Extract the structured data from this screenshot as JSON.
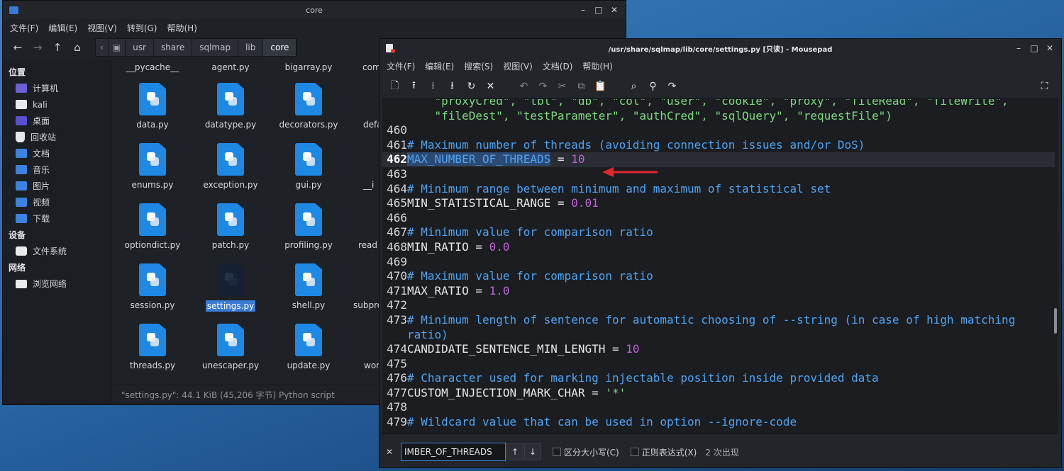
{
  "file_manager": {
    "title": "core",
    "menu": [
      "文件(F)",
      "编辑(E)",
      "视图(V)",
      "转到(G)",
      "帮助(H)"
    ],
    "path": [
      "usr",
      "share",
      "sqlmap",
      "lib",
      "core"
    ],
    "sidebar": {
      "places_heading": "位置",
      "places": [
        "计算机",
        "kali",
        "桌面",
        "回收站",
        "文档",
        "音乐",
        "图片",
        "视频",
        "下载"
      ],
      "devices_heading": "设备",
      "devices": [
        "文件系统"
      ],
      "network_heading": "网络",
      "network": [
        "浏览网络"
      ]
    },
    "files_top_row": [
      "__pycache__",
      "agent.py",
      "bigarray.py",
      "com"
    ],
    "files": [
      [
        "data.py",
        "datatype.py",
        "decorators.py",
        "defa"
      ],
      [
        "enums.py",
        "exception.py",
        "gui.py",
        "__i"
      ],
      [
        "optiondict.py",
        "patch.py",
        "profiling.py",
        "read"
      ],
      [
        "session.py",
        "settings.py",
        "shell.py",
        "subpro"
      ],
      [
        "threads.py",
        "unescaper.py",
        "update.py",
        "wor"
      ]
    ],
    "status": "\"settings.py\": 44.1 KiB (45,206 字节) Python script"
  },
  "mousepad": {
    "title": "/usr/share/sqlmap/lib/core/settings.py [只读] - Mousepad",
    "menu": [
      "文件(F)",
      "编辑(E)",
      "搜索(S)",
      "视图(V)",
      "文档(D)",
      "帮助(H)"
    ],
    "code_lines": [
      {
        "n": "",
        "s": [
          {
            "t": "    \"proxyCred\", \"tbl\", \"db\", \"col\", \"user\", \"cookie\", \"proxy\", \"fileRead\", \"fileWrite\",",
            "c": "c-str"
          }
        ]
      },
      {
        "n": "",
        "s": [
          {
            "t": "    \"fileDest\", \"testParameter\", \"authCred\", \"sqlQuery\", \"requestFile\")",
            "c": "c-str"
          }
        ]
      },
      {
        "n": "460",
        "s": []
      },
      {
        "n": "461",
        "s": [
          {
            "t": "# Maximum number of threads (avoiding connection issues and/or DoS)",
            "c": "c-comment"
          }
        ]
      },
      {
        "n": "462",
        "cur": true,
        "s": [
          {
            "t": "MAX_NUMBER_OF_THREADS",
            "c": "c-hl"
          },
          {
            "t": " = ",
            "c": "c-plain"
          },
          {
            "t": "10",
            "c": "c-num"
          }
        ]
      },
      {
        "n": "463",
        "s": []
      },
      {
        "n": "464",
        "s": [
          {
            "t": "# Minimum range between minimum and maximum of statistical set",
            "c": "c-comment"
          }
        ]
      },
      {
        "n": "465",
        "s": [
          {
            "t": "MIN_STATISTICAL_RANGE = ",
            "c": "c-plain"
          },
          {
            "t": "0.01",
            "c": "c-num"
          }
        ]
      },
      {
        "n": "466",
        "s": []
      },
      {
        "n": "467",
        "s": [
          {
            "t": "# Minimum value for comparison ratio",
            "c": "c-comment"
          }
        ]
      },
      {
        "n": "468",
        "s": [
          {
            "t": "MIN_RATIO = ",
            "c": "c-plain"
          },
          {
            "t": "0.0",
            "c": "c-num"
          }
        ]
      },
      {
        "n": "469",
        "s": []
      },
      {
        "n": "470",
        "s": [
          {
            "t": "# Maximum value for comparison ratio",
            "c": "c-comment"
          }
        ]
      },
      {
        "n": "471",
        "s": [
          {
            "t": "MAX_RATIO = ",
            "c": "c-plain"
          },
          {
            "t": "1.0",
            "c": "c-num"
          }
        ]
      },
      {
        "n": "472",
        "s": []
      },
      {
        "n": "473",
        "s": [
          {
            "t": "# Minimum length of sentence for automatic choosing of --string (in case of high matching",
            "c": "c-comment"
          }
        ]
      },
      {
        "n": "",
        "s": [
          {
            "t": "ratio)",
            "c": "c-comment"
          }
        ]
      },
      {
        "n": "474",
        "s": [
          {
            "t": "CANDIDATE_SENTENCE_MIN_LENGTH = ",
            "c": "c-plain"
          },
          {
            "t": "10",
            "c": "c-num"
          }
        ]
      },
      {
        "n": "475",
        "s": []
      },
      {
        "n": "476",
        "s": [
          {
            "t": "# Character used for marking injectable position inside provided data",
            "c": "c-comment"
          }
        ]
      },
      {
        "n": "477",
        "s": [
          {
            "t": "CUSTOM_INJECTION_MARK_CHAR = ",
            "c": "c-plain"
          },
          {
            "t": "'*'",
            "c": "c-str"
          }
        ]
      },
      {
        "n": "478",
        "s": []
      },
      {
        "n": "479",
        "s": [
          {
            "t": "# Wildcard value that can be used in option --ignore-code",
            "c": "c-comment"
          }
        ]
      }
    ],
    "search": {
      "value": "IMBER_OF_THREADS",
      "match_case_label": "区分大小写(C)",
      "regex_label": "正则表达式(X)",
      "matches": "2 次出现"
    },
    "arrow_color": "#e0262b"
  }
}
